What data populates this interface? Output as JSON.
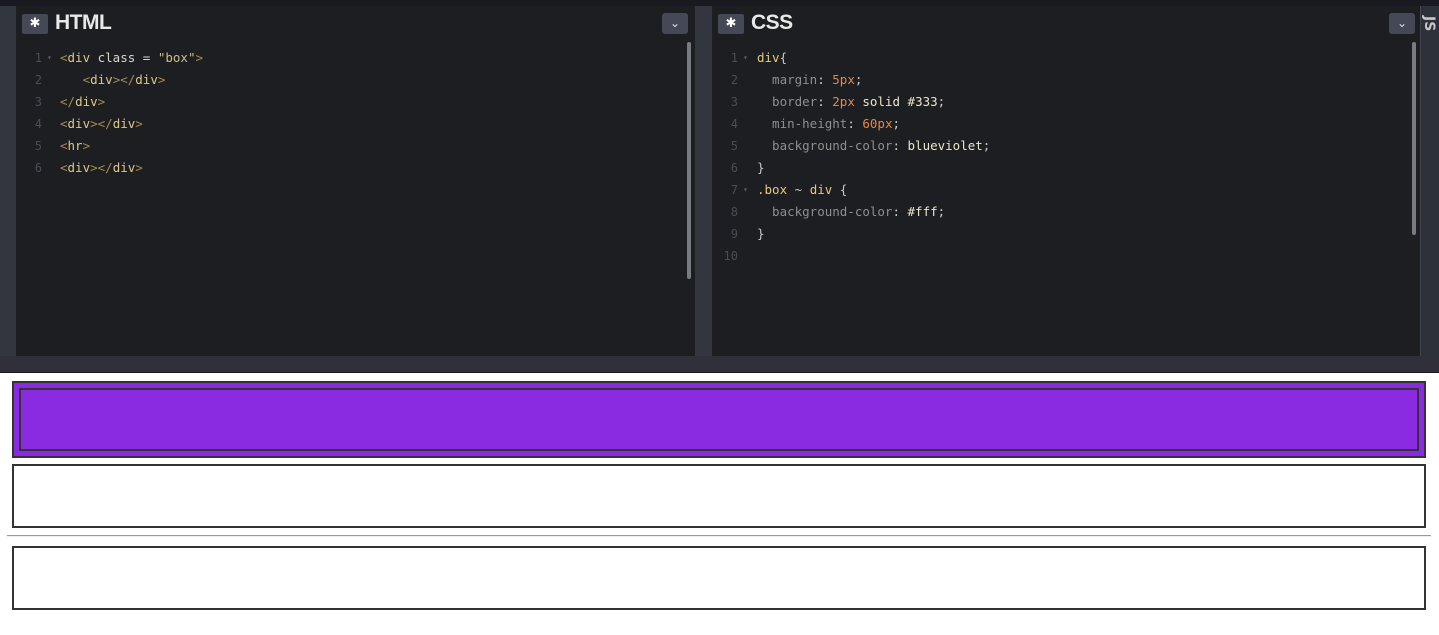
{
  "html_panel": {
    "title": "HTML",
    "gear_icon": "gear-icon",
    "gear_glyph": "✱",
    "chevron_glyph": "⌄",
    "lines": [
      {
        "num": "1",
        "fold": "▾",
        "parts": [
          [
            "tag",
            "<"
          ],
          [
            "tname",
            "div"
          ],
          [
            "attr",
            " class = "
          ],
          [
            "str",
            "\"box\""
          ],
          [
            "tag",
            ">"
          ]
        ]
      },
      {
        "num": "2",
        "fold": "",
        "parts": [
          [
            "attr",
            "   "
          ],
          [
            "tag",
            "<"
          ],
          [
            "tname",
            "div"
          ],
          [
            "tag",
            "></"
          ],
          [
            "tname",
            "div"
          ],
          [
            "tag",
            ">"
          ]
        ]
      },
      {
        "num": "3",
        "fold": "",
        "parts": [
          [
            "tag",
            "</"
          ],
          [
            "tname",
            "div"
          ],
          [
            "tag",
            ">"
          ]
        ]
      },
      {
        "num": "4",
        "fold": "",
        "parts": [
          [
            "tag",
            "<"
          ],
          [
            "tname",
            "div"
          ],
          [
            "tag",
            "></"
          ],
          [
            "tname",
            "div"
          ],
          [
            "tag",
            ">"
          ]
        ]
      },
      {
        "num": "5",
        "fold": "",
        "parts": [
          [
            "tag",
            "<"
          ],
          [
            "tname",
            "hr"
          ],
          [
            "tag",
            ">"
          ]
        ]
      },
      {
        "num": "6",
        "fold": "",
        "parts": [
          [
            "tag",
            "<"
          ],
          [
            "tname",
            "div"
          ],
          [
            "tag",
            "></"
          ],
          [
            "tname",
            "div"
          ],
          [
            "tag",
            ">"
          ]
        ]
      }
    ]
  },
  "css_panel": {
    "title": "CSS",
    "gear_icon": "gear-icon",
    "gear_glyph": "✱",
    "chevron_glyph": "⌄",
    "lines": [
      {
        "num": "1",
        "fold": "▾",
        "parts": [
          [
            "sel",
            "div"
          ],
          [
            "punc",
            "{"
          ]
        ]
      },
      {
        "num": "2",
        "fold": "",
        "parts": [
          [
            "prop",
            "  margin"
          ],
          [
            "punc",
            ": "
          ],
          [
            "num",
            "5px"
          ],
          [
            "punc",
            ";"
          ]
        ]
      },
      {
        "num": "3",
        "fold": "",
        "parts": [
          [
            "prop",
            "  border"
          ],
          [
            "punc",
            ": "
          ],
          [
            "num",
            "2px"
          ],
          [
            "val",
            " solid #333"
          ],
          [
            "punc",
            ";"
          ]
        ]
      },
      {
        "num": "4",
        "fold": "",
        "parts": [
          [
            "prop",
            "  min-height"
          ],
          [
            "punc",
            ": "
          ],
          [
            "num",
            "60px"
          ],
          [
            "punc",
            ";"
          ]
        ]
      },
      {
        "num": "5",
        "fold": "",
        "parts": [
          [
            "prop",
            "  background-color"
          ],
          [
            "punc",
            ": "
          ],
          [
            "val",
            "blueviolet"
          ],
          [
            "punc",
            ";"
          ]
        ]
      },
      {
        "num": "6",
        "fold": "",
        "parts": [
          [
            "punc",
            "}"
          ]
        ]
      },
      {
        "num": "7",
        "fold": "▾",
        "parts": [
          [
            "sel",
            ".box"
          ],
          [
            "punc",
            " ~ "
          ],
          [
            "sel",
            "div"
          ],
          [
            "punc",
            " {"
          ]
        ]
      },
      {
        "num": "8",
        "fold": "",
        "parts": [
          [
            "prop",
            "  background-color"
          ],
          [
            "punc",
            ": "
          ],
          [
            "val",
            "#fff"
          ],
          [
            "punc",
            ";"
          ]
        ]
      },
      {
        "num": "9",
        "fold": "",
        "parts": [
          [
            "punc",
            "}"
          ]
        ]
      },
      {
        "num": "10",
        "fold": "",
        "parts": []
      }
    ]
  },
  "js_panel": {
    "title": "JS"
  },
  "preview": {
    "box_color": "#8a2be2",
    "border_color": "#333333"
  }
}
